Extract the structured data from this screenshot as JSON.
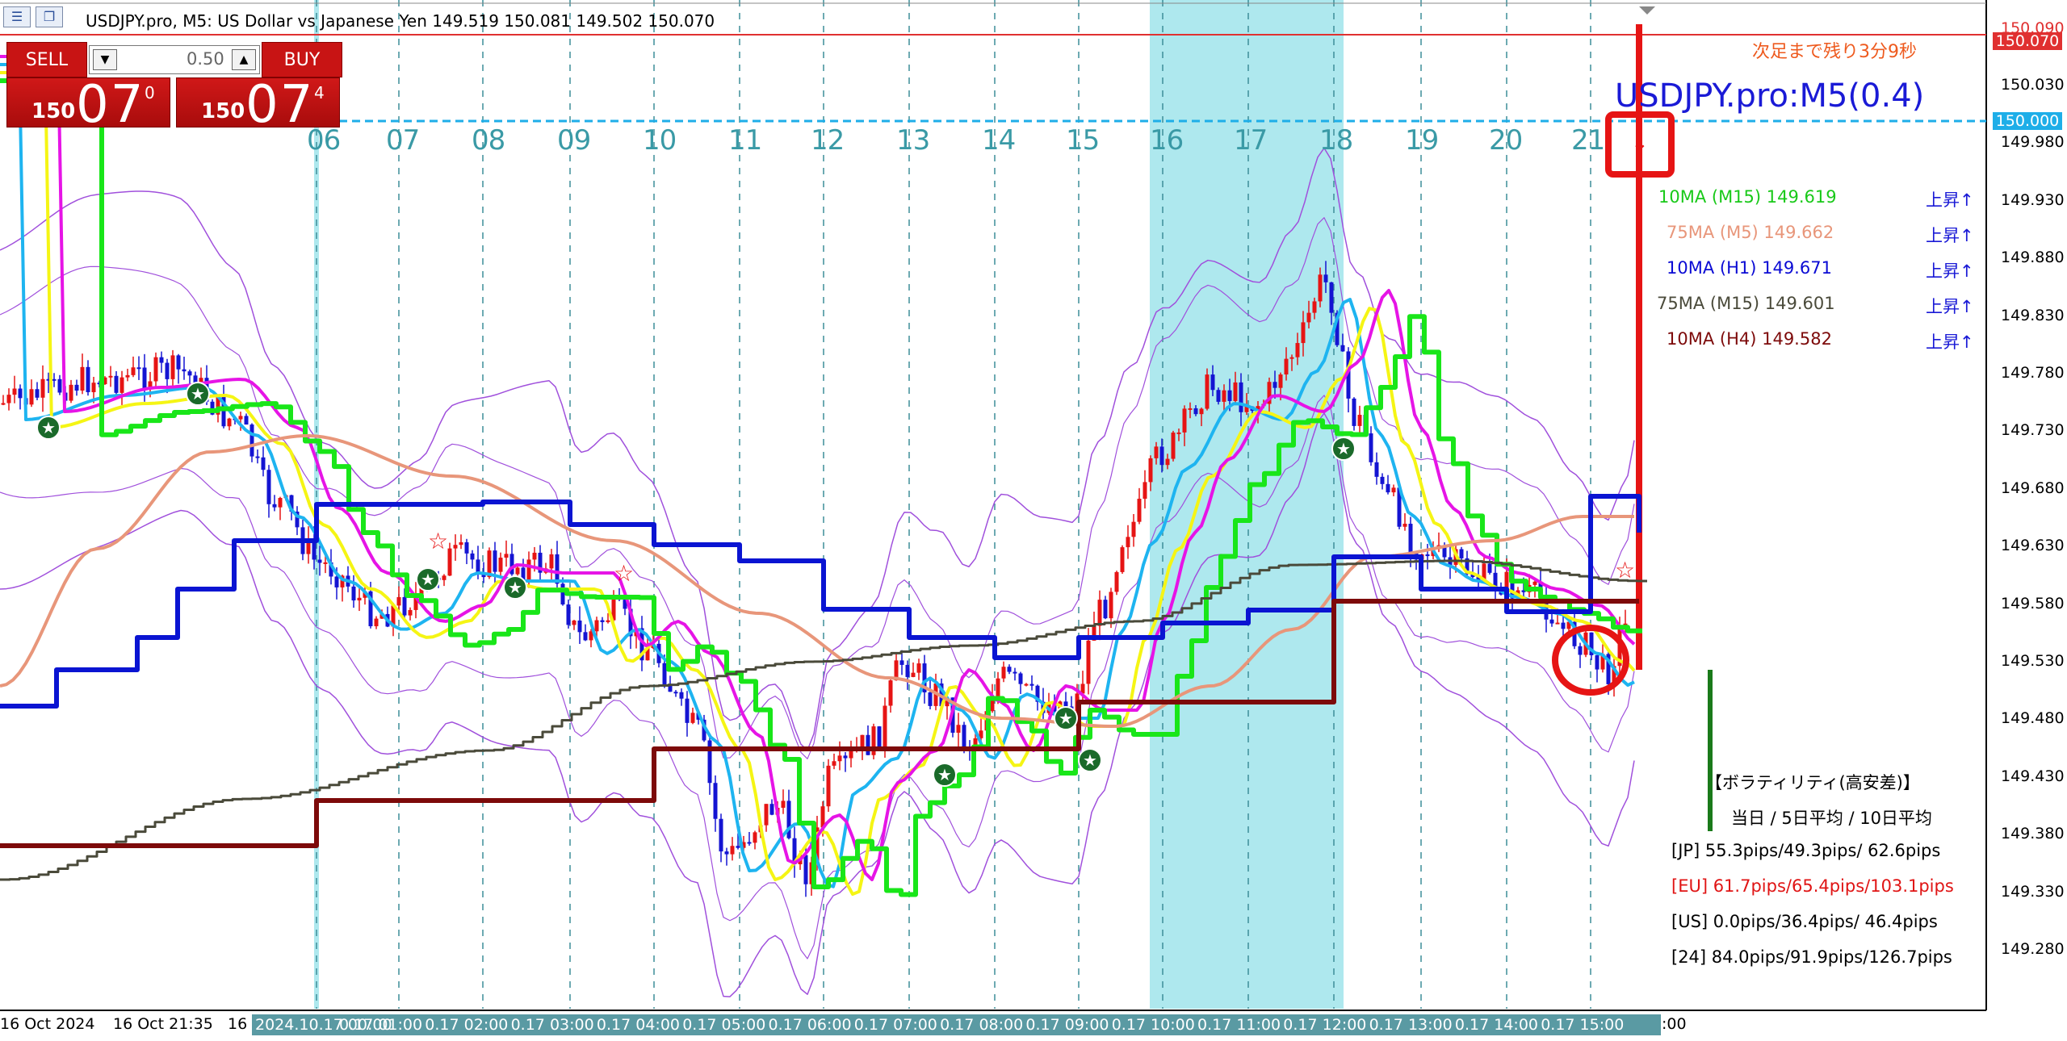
{
  "window": {
    "title": "USDJPY.pro, M5:  US Dollar vs Japanese Yen  149.519 150.081 149.502 150.070"
  },
  "trade_panel": {
    "sell_label": "SELL",
    "buy_label": "BUY",
    "lot_value": "0.50",
    "sell_price": {
      "prefix": "150",
      "main": "07",
      "sup": "0"
    },
    "buy_price": {
      "prefix": "150",
      "main": "07",
      "sup": "4"
    }
  },
  "overlay": {
    "countdown": "次足まで残り3分9秒",
    "symbol_label": "USDJPY.pro:M5(0.4)"
  },
  "ma_panel": [
    {
      "label": "10MA (M15) 149.619",
      "trend": "上昇↑",
      "color": "#19c919"
    },
    {
      "label": "75MA (M5)  149.662",
      "trend": "上昇↑",
      "color": "#e8967a"
    },
    {
      "label": "10MA (H1)  149.671",
      "trend": "上昇↑",
      "color": "#0a0ad4"
    },
    {
      "label": "75MA (M15) 149.601",
      "trend": "上昇↑",
      "color": "#4a4a3a"
    },
    {
      "label": "10MA (H4)  149.582",
      "trend": "上昇↑",
      "color": "#7d0a0a"
    }
  ],
  "volatility": {
    "title": "【ボラティリティ(高安差)】",
    "subtitle": "当日 / 5日平均 / 10日平均",
    "rows": [
      {
        "text": "[JP] 55.3pips/49.3pips/ 62.6pips",
        "color": "#000000"
      },
      {
        "text": "[EU] 61.7pips/65.4pips/103.1pips",
        "color": "#e01414"
      },
      {
        "text": "[US]  0.0pips/36.4pips/ 46.4pips",
        "color": "#000000"
      },
      {
        "text": "[24] 84.0pips/91.9pips/126.7pips",
        "color": "#000000"
      }
    ]
  },
  "price_axis": {
    "ticks": [
      "150.030",
      "149.980",
      "149.930",
      "149.880",
      "149.830",
      "149.780",
      "149.730",
      "149.680",
      "149.630",
      "149.580",
      "149.530",
      "149.480",
      "149.430",
      "149.380",
      "149.330",
      "149.280"
    ],
    "current_price": "150.070",
    "level_price": "150.000",
    "top_cut": "150.090"
  },
  "hour_labels": [
    "06",
    "07",
    "08",
    "09",
    "10",
    "11",
    "12",
    "13",
    "14",
    "15",
    "16",
    "17",
    "18",
    "19",
    "20",
    "21"
  ],
  "time_axis": {
    "left_labels": [
      "16 Oct 2024",
      "16 Oct 21:35",
      "16"
    ],
    "strip_labels": [
      "2024.10.17 00:00",
      "0.17 01:00",
      "0.17 02:00",
      "0.17 03:00",
      "0.17 04:00",
      "0.17 05:00",
      "0.17 06:00",
      "0.17 07:00",
      "0.17 08:00",
      "0.17 09:00",
      "0.17 10:00",
      "0.17 11:00",
      "0.17 12:00",
      "0.17 13:00",
      "0.17 14:00",
      "0.17 15:00"
    ],
    "tail": ":00"
  },
  "colors": {
    "ma_m15": "#19e619",
    "ma_m5": "#e8967a",
    "ma_h1": "#0a14d2",
    "ma_m15_75": "#4a4a3a",
    "ma_h4": "#7d0a0a",
    "yellow": "#f5f514",
    "magenta": "#e614e6",
    "cyan": "#1eb4f0",
    "bands": "#a050dc",
    "session": "#aee8ee",
    "bull": "#e61414",
    "bear": "#1414d2",
    "highlight": "#e61414"
  }
}
